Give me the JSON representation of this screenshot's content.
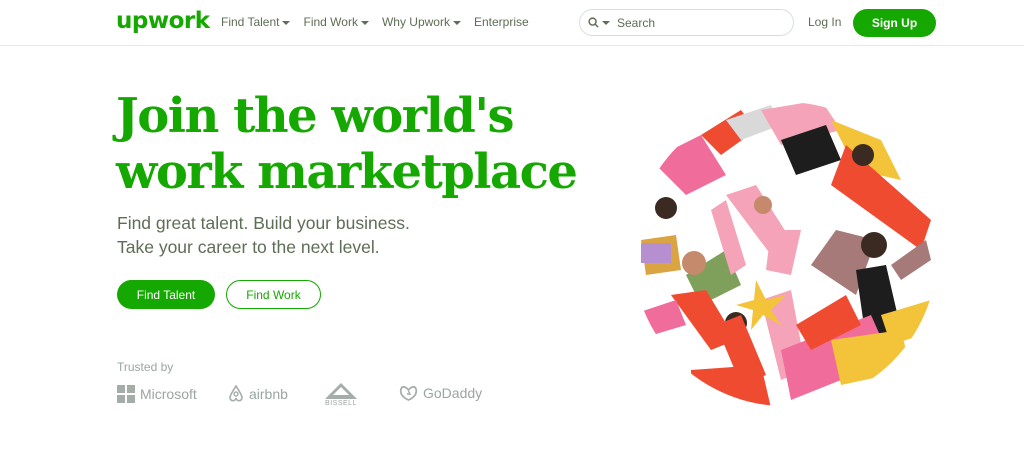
{
  "nav": {
    "logo": "upwork",
    "menu": [
      {
        "label": "Find Talent",
        "has_dropdown": true
      },
      {
        "label": "Find Work",
        "has_dropdown": true
      },
      {
        "label": "Why Upwork",
        "has_dropdown": true
      },
      {
        "label": "Enterprise",
        "has_dropdown": false
      }
    ],
    "search": {
      "placeholder": "Search",
      "icon": "search-icon"
    },
    "login_label": "Log In",
    "signup_label": "Sign Up"
  },
  "hero": {
    "title_line1": "Join the world's",
    "title_line2": "work marketplace",
    "subtitle_line1": "Find great talent. Build your business.",
    "subtitle_line2": "Take your career to the next level.",
    "primary_cta": "Find Talent",
    "secondary_cta": "Find Work"
  },
  "trusted": {
    "label": "Trusted by",
    "brands": [
      "Microsoft",
      "airbnb",
      "BISSELL",
      "GoDaddy"
    ]
  },
  "colors": {
    "brand_green": "#14a800",
    "muted_text": "#5e6d55",
    "logo_gray": "#9aa5a0"
  }
}
